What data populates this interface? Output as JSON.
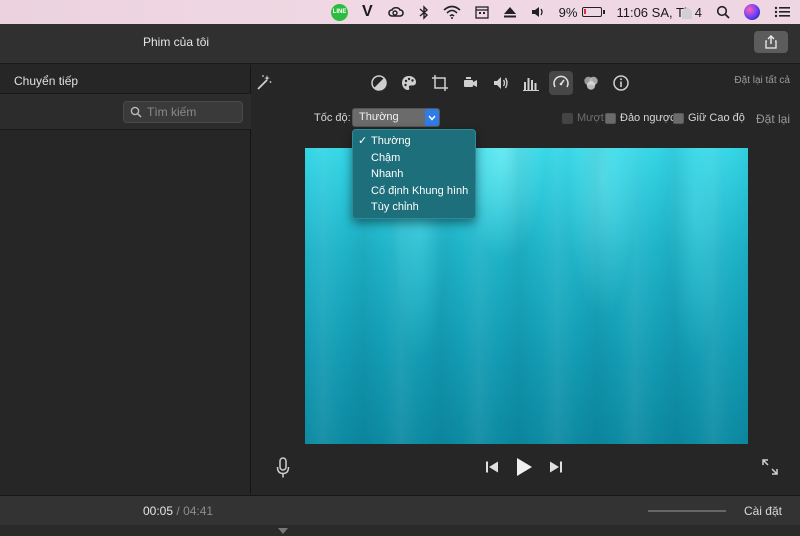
{
  "menubar": {
    "battery_percent": "9%",
    "battery_level": 0.09,
    "clock": "11:06 SA, Th 4",
    "icons": [
      "line-icon",
      "v-icon",
      "creative-cloud-icon",
      "bluetooth-icon",
      "wifi-icon",
      "calendar-icon",
      "eject-icon",
      "volume-icon",
      "battery-icon",
      "search-icon",
      "siri-icon",
      "menu-list-icon"
    ],
    "line_label": "LINE",
    "v_label": "V"
  },
  "app": {
    "title": "Phim của tôi",
    "share_icon": "share-icon"
  },
  "left_panel": {
    "title": "Chuyển tiếp",
    "search_placeholder": "Tìm kiếm"
  },
  "viewer": {
    "tools": [
      "magic-wand-icon",
      "color-balance-icon",
      "color-palette-icon",
      "crop-icon",
      "camera-stabilize-icon",
      "volume-icon",
      "equalizer-icon",
      "speedometer-icon",
      "filter-icon",
      "info-icon"
    ],
    "active_tool": "speedometer-icon",
    "reset_all": "Đặt lại tất cả",
    "speed": {
      "label": "Tốc độ:",
      "selected": "Thường",
      "options": [
        {
          "label": "Thường",
          "checked": true
        },
        {
          "label": "Chậm",
          "checked": false
        },
        {
          "label": "Nhanh",
          "checked": false
        },
        {
          "label": "Cố định Khung hình",
          "checked": false
        },
        {
          "label": "Tùy chỉnh",
          "checked": false
        }
      ],
      "check_mark": "✓"
    },
    "checkboxes": [
      {
        "label": "Mượt",
        "enabled": false
      },
      {
        "label": "Đảo ngược",
        "enabled": true
      },
      {
        "label": "Giữ Cao độ",
        "enabled": true
      }
    ],
    "reset": "Đặt lại"
  },
  "bottom_bar": {
    "current_time": "00:05",
    "separator": "/",
    "total_time": "04:41",
    "settings": "Cài đặt",
    "zoom_level": 0.5
  },
  "colors": {
    "video_top": "#35d6e6",
    "video_bottom": "#0d8aa2",
    "menu_bg": "#1d6f7b",
    "select_arrow": "#2f7ce6"
  }
}
